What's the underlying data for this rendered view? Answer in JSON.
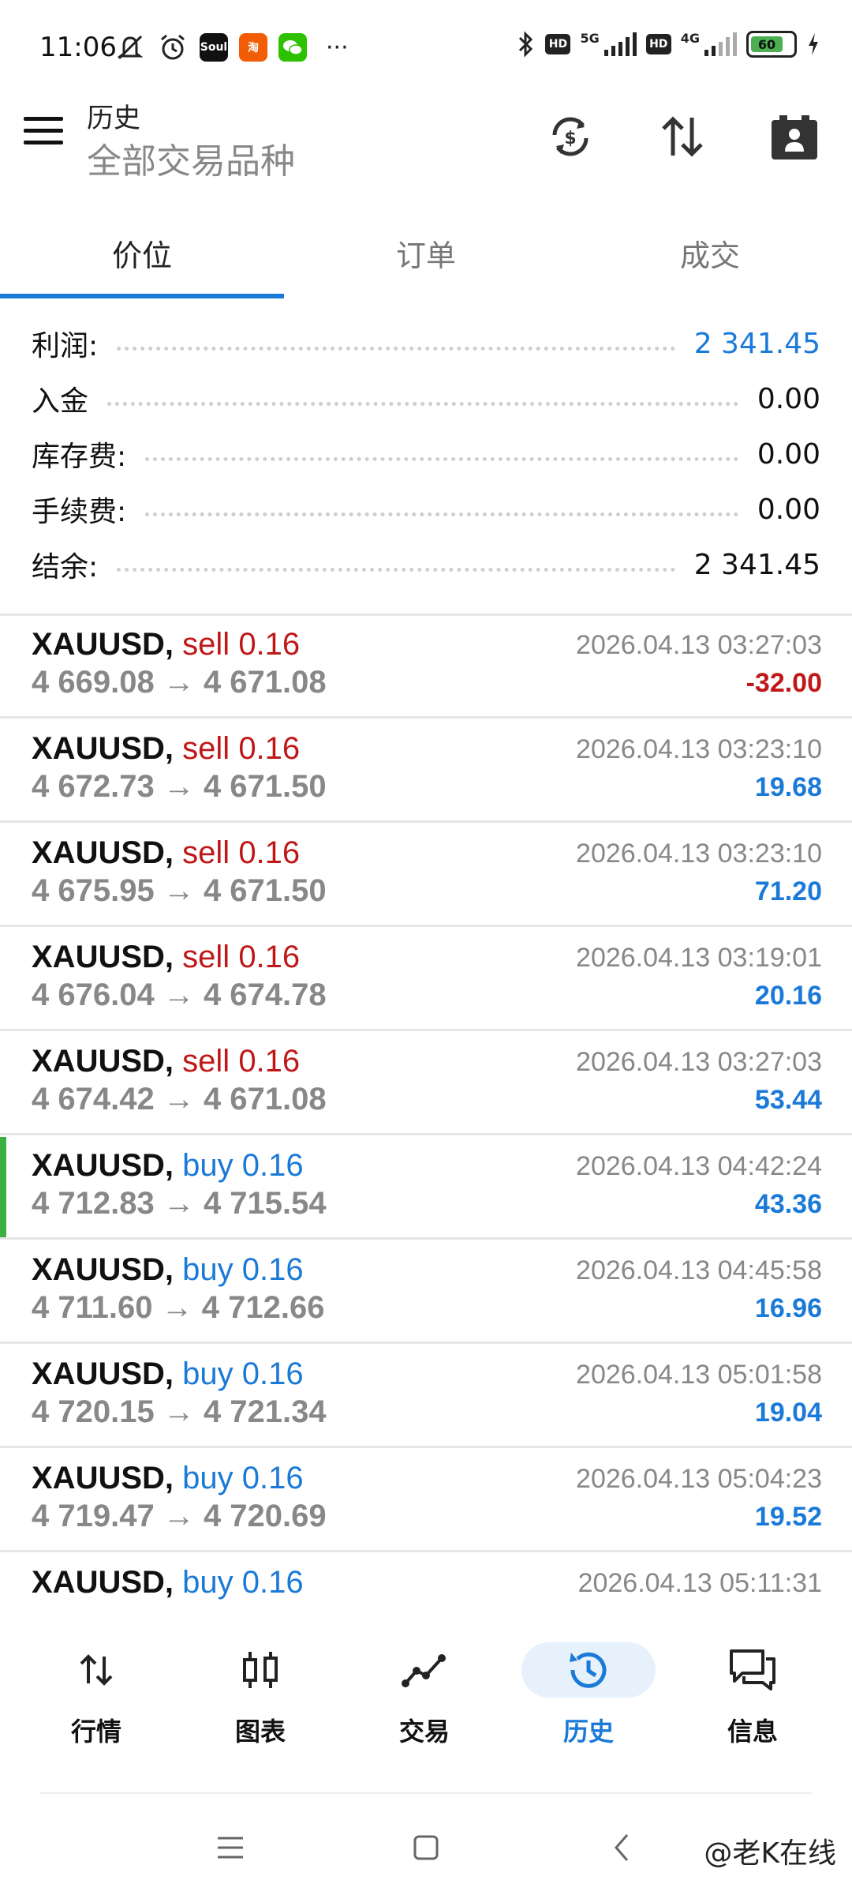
{
  "status": {
    "time": "11:06",
    "battery": "60",
    "net1": "5G",
    "net2": "4G",
    "hd": "HD",
    "app_soul": "Soul",
    "app_tao": "淘",
    "more": "···"
  },
  "header": {
    "title": "历史",
    "subtitle": "全部交易品种"
  },
  "tabs": [
    {
      "label": "价位",
      "active": true
    },
    {
      "label": "订单",
      "active": false
    },
    {
      "label": "成交",
      "active": false
    }
  ],
  "summary": [
    {
      "label": "利润:",
      "value": "2 341.45",
      "highlight": true
    },
    {
      "label": "入金",
      "value": "0.00",
      "highlight": false
    },
    {
      "label": "库存费:",
      "value": "0.00",
      "highlight": false
    },
    {
      "label": "手续费:",
      "value": "0.00",
      "highlight": false
    },
    {
      "label": "结余:",
      "value": "2 341.45",
      "highlight": false
    }
  ],
  "deals": [
    {
      "symbol": "XAUUSD,",
      "side": "sell",
      "volume": "0.16",
      "open": "4 669.08",
      "close": "4 671.08",
      "time": "2026.04.13 03:27:03",
      "profit": "-32.00",
      "negative": true,
      "marked": false
    },
    {
      "symbol": "XAUUSD,",
      "side": "sell",
      "volume": "0.16",
      "open": "4 672.73",
      "close": "4 671.50",
      "time": "2026.04.13 03:23:10",
      "profit": "19.68",
      "negative": false,
      "marked": false
    },
    {
      "symbol": "XAUUSD,",
      "side": "sell",
      "volume": "0.16",
      "open": "4 675.95",
      "close": "4 671.50",
      "time": "2026.04.13 03:23:10",
      "profit": "71.20",
      "negative": false,
      "marked": false
    },
    {
      "symbol": "XAUUSD,",
      "side": "sell",
      "volume": "0.16",
      "open": "4 676.04",
      "close": "4 674.78",
      "time": "2026.04.13 03:19:01",
      "profit": "20.16",
      "negative": false,
      "marked": false
    },
    {
      "symbol": "XAUUSD,",
      "side": "sell",
      "volume": "0.16",
      "open": "4 674.42",
      "close": "4 671.08",
      "time": "2026.04.13 03:27:03",
      "profit": "53.44",
      "negative": false,
      "marked": false
    },
    {
      "symbol": "XAUUSD,",
      "side": "buy",
      "volume": "0.16",
      "open": "4 712.83",
      "close": "4 715.54",
      "time": "2026.04.13 04:42:24",
      "profit": "43.36",
      "negative": false,
      "marked": true
    },
    {
      "symbol": "XAUUSD,",
      "side": "buy",
      "volume": "0.16",
      "open": "4 711.60",
      "close": "4 712.66",
      "time": "2026.04.13 04:45:58",
      "profit": "16.96",
      "negative": false,
      "marked": false
    },
    {
      "symbol": "XAUUSD,",
      "side": "buy",
      "volume": "0.16",
      "open": "4 720.15",
      "close": "4 721.34",
      "time": "2026.04.13 05:01:58",
      "profit": "19.04",
      "negative": false,
      "marked": false
    },
    {
      "symbol": "XAUUSD,",
      "side": "buy",
      "volume": "0.16",
      "open": "4 719.47",
      "close": "4 720.69",
      "time": "2026.04.13 05:04:23",
      "profit": "19.52",
      "negative": false,
      "marked": false
    },
    {
      "symbol": "XAUUSD,",
      "side": "buy",
      "volume": "0.16",
      "open": "",
      "close": "",
      "time": "2026.04.13 05:11:31",
      "profit": "",
      "negative": false,
      "marked": false
    }
  ],
  "nav": [
    {
      "label": "行情",
      "icon": "quotes-icon",
      "active": false
    },
    {
      "label": "图表",
      "icon": "chart-icon",
      "active": false
    },
    {
      "label": "交易",
      "icon": "trade-icon",
      "active": false
    },
    {
      "label": "历史",
      "icon": "history-icon",
      "active": true
    },
    {
      "label": "信息",
      "icon": "messages-icon",
      "active": false
    }
  ],
  "watermark": "@老K在线",
  "colors": {
    "accent": "#1b7ad8",
    "sell": "#c01818",
    "marker": "#3cb043"
  }
}
